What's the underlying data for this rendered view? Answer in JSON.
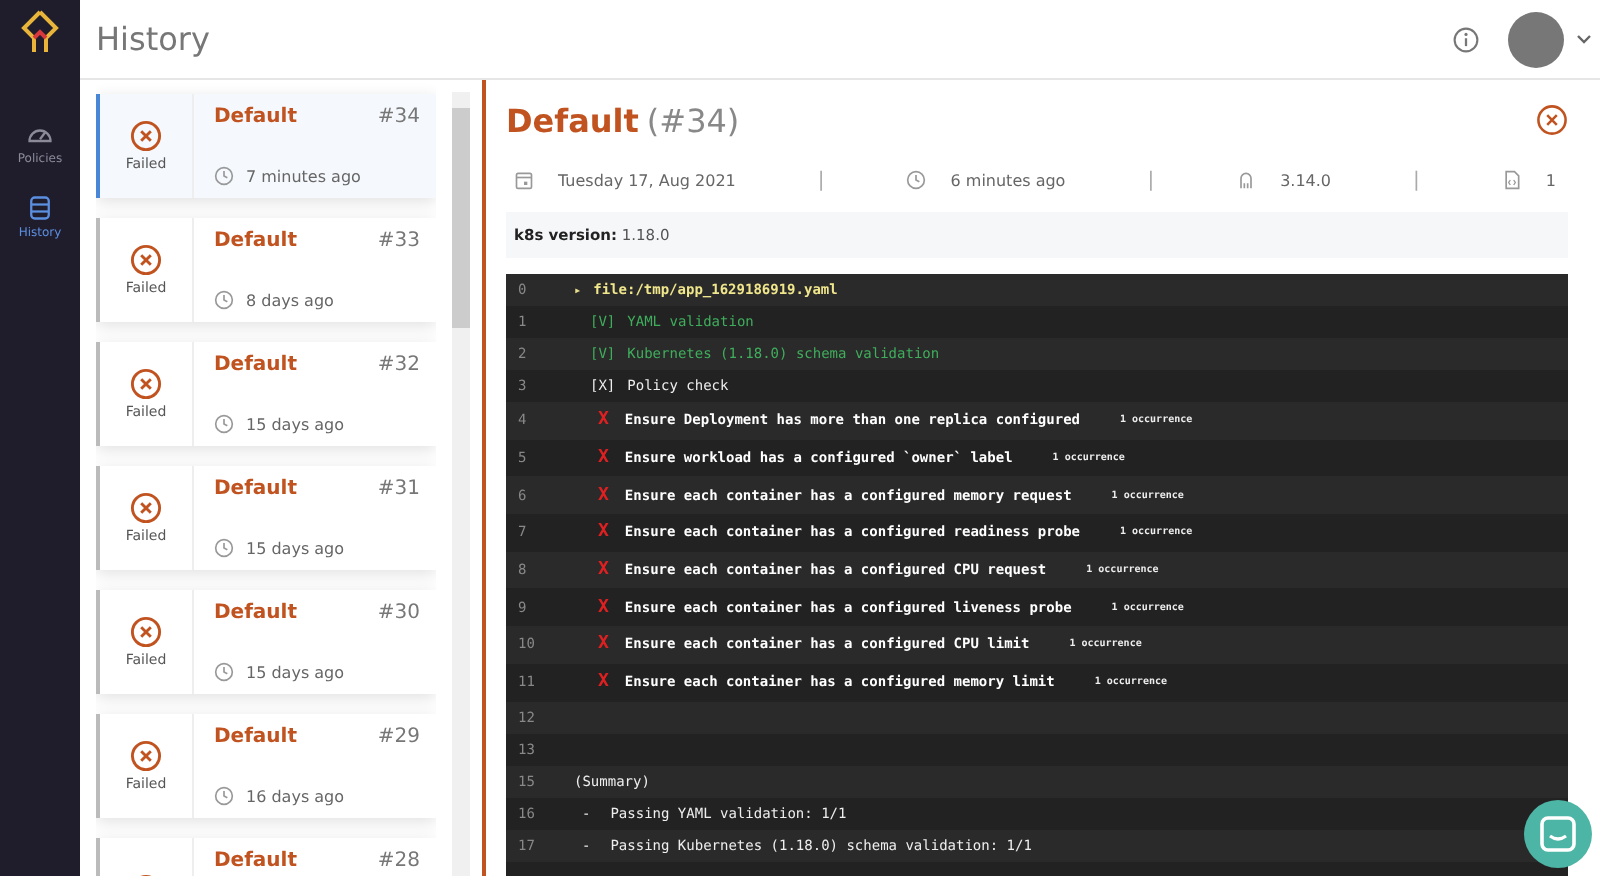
{
  "header": {
    "title": "History"
  },
  "nav": [
    {
      "label": "Policies",
      "kind": "gauge",
      "selected": false
    },
    {
      "label": "History",
      "kind": "database",
      "selected": true
    }
  ],
  "runs": [
    {
      "name": "Default",
      "number": "#34",
      "status": "Failed",
      "time": "7 minutes ago",
      "selected": true
    },
    {
      "name": "Default",
      "number": "#33",
      "status": "Failed",
      "time": "8 days ago",
      "selected": false
    },
    {
      "name": "Default",
      "number": "#32",
      "status": "Failed",
      "time": "15 days ago",
      "selected": false
    },
    {
      "name": "Default",
      "number": "#31",
      "status": "Failed",
      "time": "15 days ago",
      "selected": false
    },
    {
      "name": "Default",
      "number": "#30",
      "status": "Failed",
      "time": "15 days ago",
      "selected": false
    },
    {
      "name": "Default",
      "number": "#29",
      "status": "Failed",
      "time": "16 days ago",
      "selected": false
    },
    {
      "name": "Default",
      "number": "#28",
      "selected": false
    }
  ],
  "detail": {
    "name": "Default",
    "number": "(#34)",
    "meta": [
      {
        "kind": "calendar",
        "text": "Tuesday 17, Aug 2021"
      },
      {
        "kind": "clock",
        "text": "6 minutes ago"
      },
      {
        "kind": "version",
        "text": "3.14.0"
      },
      {
        "kind": "file",
        "text": "1"
      }
    ],
    "separator": "|",
    "k8s": {
      "label": "k8s version:",
      "value": "1.18.0"
    },
    "log": [
      {
        "number": "0",
        "kind": "file",
        "mark": "▸",
        "text": "file:/tmp/app_1629186919.yaml"
      },
      {
        "number": "1",
        "kind": "pass",
        "mark": "[V]",
        "text": "YAML validation"
      },
      {
        "number": "2",
        "kind": "pass",
        "mark": "[V]",
        "text": "Kubernetes (1.18.0) schema validation"
      },
      {
        "number": "3",
        "kind": "check",
        "mark": "[X]",
        "text": "Policy check"
      },
      {
        "number": "4",
        "kind": "fail",
        "mark": "X",
        "text": "Ensure Deployment has more than one replica configured",
        "note": "1 occurrence"
      },
      {
        "number": "5",
        "kind": "fail",
        "mark": "X",
        "text": "Ensure workload has a configured `owner` label",
        "note": "1 occurrence"
      },
      {
        "number": "6",
        "kind": "fail",
        "mark": "X",
        "text": "Ensure each container has a configured memory request",
        "note": "1 occurrence"
      },
      {
        "number": "7",
        "kind": "fail",
        "mark": "X",
        "text": "Ensure each container has a configured readiness probe",
        "note": "1 occurrence"
      },
      {
        "number": "8",
        "kind": "fail",
        "mark": "X",
        "text": "Ensure each container has a configured CPU request",
        "note": "1 occurrence"
      },
      {
        "number": "9",
        "kind": "fail",
        "mark": "X",
        "text": "Ensure each container has a configured liveness probe",
        "note": "1 occurrence"
      },
      {
        "number": "10",
        "kind": "fail",
        "mark": "X",
        "text": "Ensure each container has a configured CPU limit",
        "note": "1 occurrence"
      },
      {
        "number": "11",
        "kind": "fail",
        "mark": "X",
        "text": "Ensure each container has a configured memory limit",
        "note": "1 occurrence"
      },
      {
        "number": "12",
        "kind": "blank"
      },
      {
        "number": "13",
        "kind": "blank"
      },
      {
        "number": "15",
        "kind": "plain",
        "text": "(Summary)"
      },
      {
        "number": "16",
        "kind": "item",
        "mark": "-",
        "text": "Passing YAML validation: 1/1"
      },
      {
        "number": "17",
        "kind": "item",
        "mark": "-",
        "text": "Passing Kubernetes (1.18.0) schema validation: 1/1"
      }
    ]
  }
}
